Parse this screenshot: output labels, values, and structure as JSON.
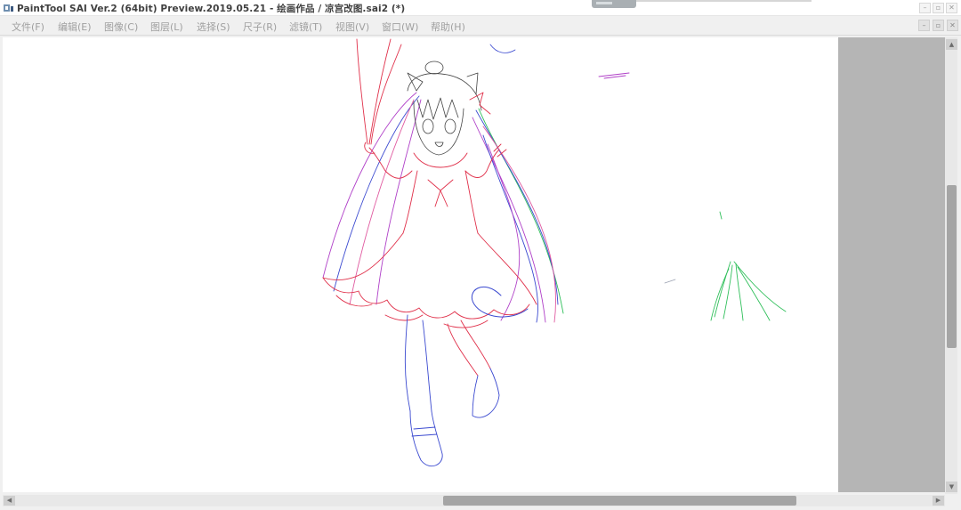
{
  "window": {
    "title": "PaintTool SAI Ver.2 (64bit) Preview.2019.05.21 - 绘画作品 / 凉宫改图.sai2 (*)",
    "controls": {
      "minimize": "–",
      "maximize": "▫",
      "close": "✕"
    }
  },
  "menu": {
    "items": [
      {
        "label": "文件(F)"
      },
      {
        "label": "编辑(E)"
      },
      {
        "label": "图像(C)"
      },
      {
        "label": "图层(L)"
      },
      {
        "label": "选择(S)"
      },
      {
        "label": "尺子(R)"
      },
      {
        "label": "滤镜(T)"
      },
      {
        "label": "视图(V)"
      },
      {
        "label": "窗口(W)"
      },
      {
        "label": "帮助(H)"
      }
    ]
  },
  "document_controls": {
    "minimize": "–",
    "restore": "▫",
    "close": "✕"
  },
  "scrollbars": {
    "vertical": {
      "up_arrow": "▲",
      "down_arrow": "▼"
    },
    "horizontal": {
      "left_arrow": "◀",
      "right_arrow": "▶"
    }
  },
  "colors": {
    "sketch_red": "#e0304a",
    "sketch_blue": "#3b4ad0",
    "sketch_purple": "#b040c8",
    "sketch_green": "#2fbf5a",
    "sketch_pink": "#e05aa0",
    "workspace_gray": "#b5b5b5"
  }
}
